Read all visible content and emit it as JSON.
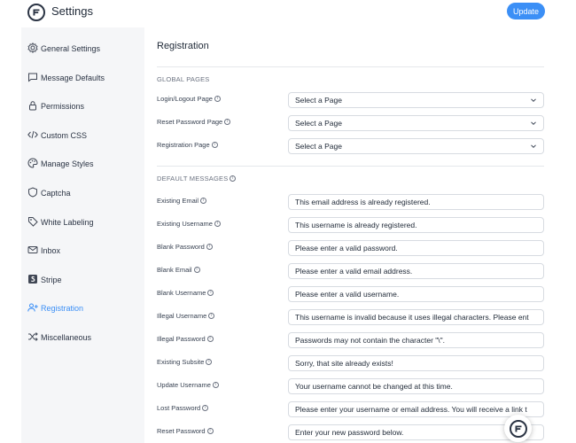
{
  "app": {
    "title": "Settings",
    "update_label": "Update"
  },
  "sidebar": {
    "items": [
      {
        "label": "General Settings",
        "icon": "gear-icon",
        "active": false
      },
      {
        "label": "Message Defaults",
        "icon": "message-icon",
        "active": false
      },
      {
        "label": "Permissions",
        "icon": "lock-icon",
        "active": false
      },
      {
        "label": "Custom CSS",
        "icon": "code-icon",
        "active": false
      },
      {
        "label": "Manage Styles",
        "icon": "palette-icon",
        "active": false
      },
      {
        "label": "Captcha",
        "icon": "shield-icon",
        "active": false
      },
      {
        "label": "White Labeling",
        "icon": "tag-icon",
        "active": false
      },
      {
        "label": "Inbox",
        "icon": "mail-icon",
        "active": false
      },
      {
        "label": "Stripe",
        "icon": "stripe-icon",
        "active": false
      },
      {
        "label": "Registration",
        "icon": "user-plus-icon",
        "active": true
      },
      {
        "label": "Miscellaneous",
        "icon": "shuffle-icon",
        "active": false
      }
    ]
  },
  "main": {
    "title": "Registration",
    "global_pages": {
      "heading": "GLOBAL PAGES",
      "rows": [
        {
          "label": "Login/Logout Page",
          "value": "Select a Page"
        },
        {
          "label": "Reset Password Page",
          "value": "Select a Page"
        },
        {
          "label": "Registration Page",
          "value": "Select a Page"
        }
      ]
    },
    "default_messages": {
      "heading": "DEFAULT MESSAGES",
      "rows": [
        {
          "label": "Existing Email",
          "value": "This email address is already registered."
        },
        {
          "label": "Existing Username",
          "value": "This username is already registered."
        },
        {
          "label": "Blank Password",
          "value": "Please enter a valid password."
        },
        {
          "label": "Blank Email",
          "value": "Please enter a valid email address."
        },
        {
          "label": "Blank Username",
          "value": "Please enter a valid username."
        },
        {
          "label": "Illegal Username",
          "value": "This username is invalid because it uses illegal characters. Please ent"
        },
        {
          "label": "Illegal Password",
          "value": "Passwords may not contain the character \"\\\"."
        },
        {
          "label": "Existing Subsite",
          "value": "Sorry, that site already exists!"
        },
        {
          "label": "Update Username",
          "value": "Your username cannot be changed at this time."
        },
        {
          "label": "Lost Password",
          "value": "Please enter your username or email address. You will receive a link t"
        },
        {
          "label": "Reset Password",
          "value": "Enter your new password below."
        }
      ]
    }
  },
  "colors": {
    "accent": "#3b8ff6",
    "sidebar_bg": "#f5f6f8"
  }
}
